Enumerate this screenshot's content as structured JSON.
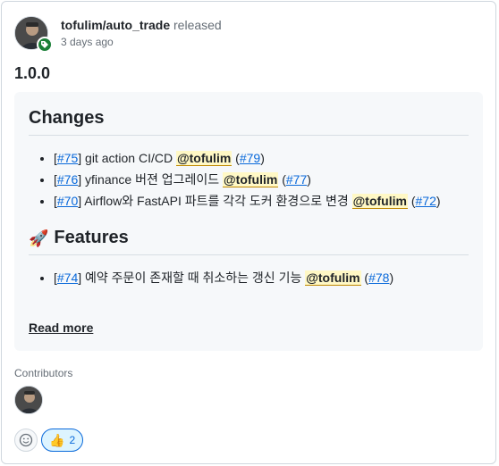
{
  "header": {
    "repo": "tofulim/auto_trade",
    "action": "released",
    "time": "3 days ago"
  },
  "release": {
    "version": "1.0.0"
  },
  "changes": {
    "title": "Changes",
    "items": [
      {
        "pr": "#75",
        "text": "git action CI/CD",
        "mention": "@tofulim",
        "ref": "#79"
      },
      {
        "pr": "#76",
        "text": "yfinance 버젼 업그레이드",
        "mention": "@tofulim",
        "ref": "#77"
      },
      {
        "pr": "#70",
        "text": "Airflow와 FastAPI 파트를 각각 도커 환경으로 변경",
        "mention": "@tofulim",
        "ref": "#72"
      }
    ]
  },
  "features": {
    "icon": "🚀",
    "title": "Features",
    "items": [
      {
        "pr": "#74",
        "text": "예약 주문이 존재할 때 취소하는 갱신 기능",
        "mention": "@tofulim",
        "ref": "#78"
      }
    ]
  },
  "read_more": "Read more",
  "contributors": {
    "label": "Contributors"
  },
  "reactions": {
    "thumbs_icon": "👍",
    "thumbs_count": "2"
  },
  "colors": {
    "link": "#0969da",
    "tag_badge": "#1a7f37",
    "mention_bg": "#fff8c5"
  }
}
